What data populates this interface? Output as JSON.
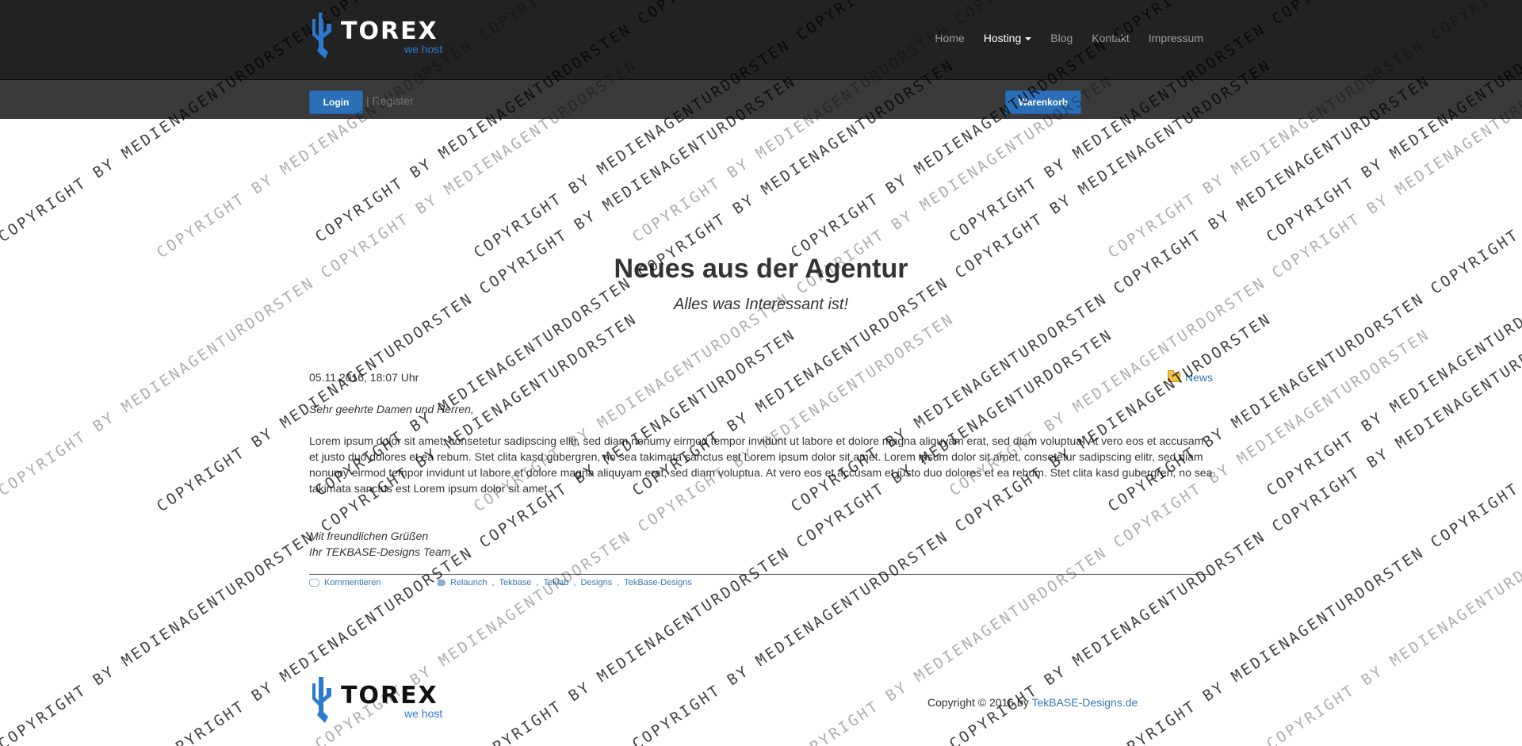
{
  "brand": {
    "name": "TOREX",
    "tagline": "we host",
    "accent_color": "#2a7bd0"
  },
  "nav": {
    "items": [
      {
        "label": "Home",
        "active": false
      },
      {
        "label": "Hosting",
        "active": true,
        "has_dropdown": true
      },
      {
        "label": "Blog",
        "active": false
      },
      {
        "label": "Kontakt",
        "active": false
      },
      {
        "label": "Impressum",
        "active": false
      }
    ]
  },
  "account": {
    "login_label": "Login",
    "register_label": "| Register",
    "cart_label": "Warenkorb"
  },
  "page": {
    "title": "Neues aus der Agentur",
    "subtitle": "Alles was Interessant ist!"
  },
  "post": {
    "date": "05.11.2016, 18:07 Uhr",
    "category": "News",
    "salutation": "Sehr geehrte Damen und Herren,",
    "body": "Lorem ipsum dolor sit amet, consetetur sadipscing elitr, sed diam nonumy eirmod tempor invidunt ut labore et dolore magna aliquyam erat, sed diam voluptua. At vero eos et accusam et justo duo dolores et ea rebum. Stet clita kasd gubergren, no sea takimata sanctus est Lorem ipsum dolor sit amet. Lorem ipsum dolor sit amet, consetetur sadipscing elitr, sed diam nonumy eirmod tempor invidunt ut labore et dolore magna aliquyam erat, sed diam voluptua. At vero eos et accusam et justo duo dolores et ea rebum. Stet clita kasd gubergren, no sea takimata sanctus est Lorem ipsum dolor sit amet.",
    "closing_line1": "Mit freundlichen Grüßen",
    "closing_line2": "Ihr TEKBASE-Designs Team",
    "comments_label": "Kommentieren",
    "tags": [
      "Relaunch",
      "Tekbase",
      "Teklab",
      "Designs",
      "TekBase-Designs"
    ]
  },
  "footer": {
    "copyright_prefix": "Copyright © 2016 by ",
    "copyright_link": "TekBASE-Designs.de"
  },
  "watermark": {
    "line1": "COPYRIGHT BY MEDIENAGENTURDORSTEN",
    "line2": "MEDIENAGENTURDORSTEN"
  },
  "colors": {
    "topbar": "#222222",
    "subbar": "#3a3a3a",
    "button": "#2a6fb7",
    "link": "#337ab7"
  }
}
